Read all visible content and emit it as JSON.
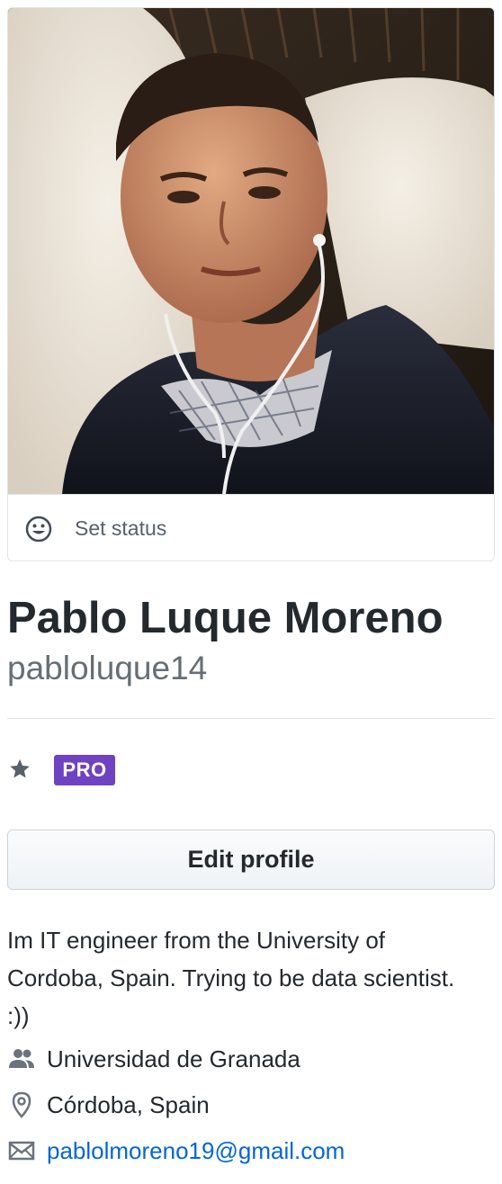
{
  "profile": {
    "status_label": "Set status",
    "full_name": "Pablo Luque Moreno",
    "username": "pabloluque14",
    "pro_badge": "PRO",
    "edit_profile_label": "Edit profile",
    "bio": "Im IT engineer from the University of Cordoba, Spain. Trying to be data scientist. :))",
    "organization": "Universidad de Granada",
    "location": "Córdoba, Spain",
    "email": "pablolmoreno19@gmail.com"
  },
  "icons": {
    "status": "smiley-icon",
    "star": "star-icon",
    "organization": "people-icon",
    "location": "location-pin-icon",
    "email": "mail-icon"
  },
  "colors": {
    "pro_badge": "#6f42c1",
    "link": "#0366d6",
    "muted_text": "#586069",
    "border": "#e1e4e8"
  }
}
